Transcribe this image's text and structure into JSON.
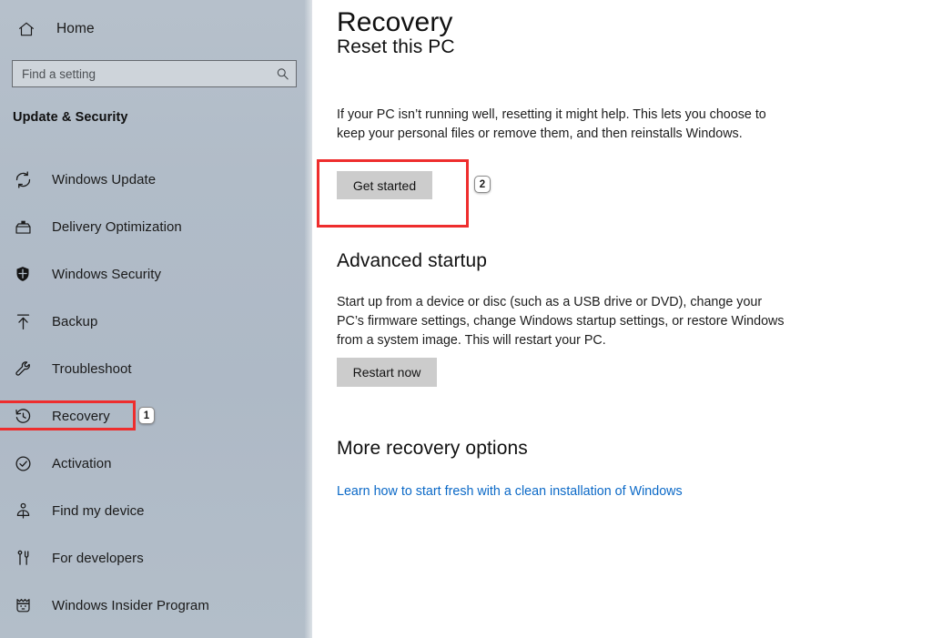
{
  "sidebar": {
    "home": {
      "label": "Home",
      "icon": "home-icon"
    },
    "search": {
      "value": "",
      "placeholder": "Find a setting",
      "icon": "search-icon"
    },
    "section_title": "Update & Security",
    "items": [
      {
        "label": "Windows Update",
        "icon": "refresh-icon"
      },
      {
        "label": "Delivery Optimization",
        "icon": "delivery-box-icon"
      },
      {
        "label": "Windows Security",
        "icon": "shield-icon"
      },
      {
        "label": "Backup",
        "icon": "upload-arrow-icon"
      },
      {
        "label": "Troubleshoot",
        "icon": "wrench-icon"
      },
      {
        "label": "Recovery",
        "icon": "history-clock-icon"
      },
      {
        "label": "Activation",
        "icon": "check-circle-icon"
      },
      {
        "label": "Find my device",
        "icon": "person-pin-icon"
      },
      {
        "label": "For developers",
        "icon": "tools-icon"
      },
      {
        "label": "Windows Insider Program",
        "icon": "ninjacat-icon"
      }
    ]
  },
  "main": {
    "page_title": "Recovery",
    "reset": {
      "heading": "Reset this PC",
      "description": "If your PC isn’t running well, resetting it might help. This lets you choose to keep your personal files or remove them, and then reinstalls Windows.",
      "button_label": "Get started"
    },
    "advanced_startup": {
      "heading": "Advanced startup",
      "description": "Start up from a device or disc (such as a USB drive or DVD), change your PC’s firmware settings, change Windows startup settings, or restore Windows from a system image. This will restart your PC.",
      "button_label": "Restart now"
    },
    "more_options": {
      "heading": "More recovery options",
      "link_label": "Learn how to start fresh with a clean installation of Windows"
    }
  },
  "annotations": {
    "highlight_color": "#ee2d2d",
    "badges": [
      {
        "label": "1"
      },
      {
        "label": "2"
      }
    ]
  }
}
